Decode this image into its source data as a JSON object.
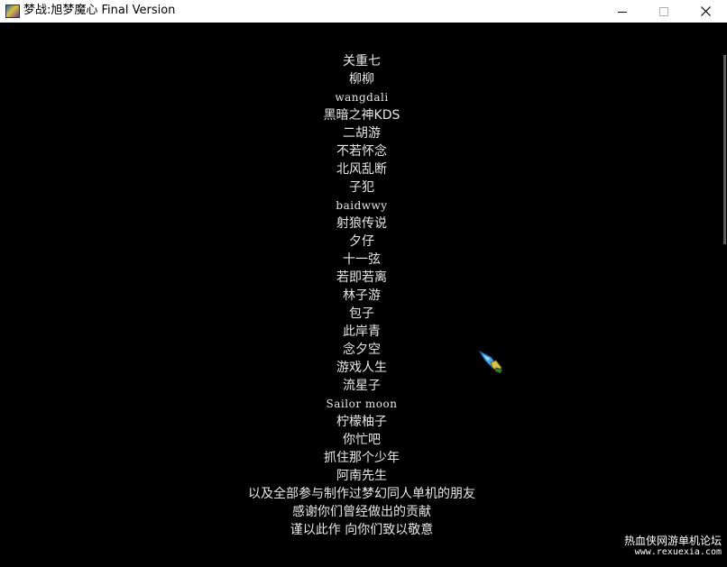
{
  "window": {
    "title": "梦战:旭梦魔心 Final Version",
    "app_icon": "game-app-icon",
    "controls": {
      "minimize_icon": "minimize-icon",
      "maximize_icon": "maximize-icon",
      "close_icon": "close-icon"
    }
  },
  "credits": [
    "关重七",
    "柳柳",
    "wangdali",
    "黑暗之神KDS",
    "二胡游",
    "不若怀念",
    "北风乱断",
    "子犯",
    "baidwwy",
    "射狼传说",
    "夕仔",
    "十一弦",
    "若即若离",
    "林子游",
    "包子",
    "此岸青",
    "念夕空",
    "游戏人生",
    "流星子",
    "Sailor moon",
    "柠檬柚子",
    "你忙吧",
    "抓住那个少年",
    "阿南先生",
    "以及全部参与制作过梦幻同人单机的朋友",
    "感谢你们曾经做出的贡献",
    "谨以此作 向你们致以敬意"
  ],
  "cursor_icon": "sword-cursor-icon",
  "watermark": {
    "line1": "热血侠网游单机论坛",
    "line2": "www.rexuexia.com"
  },
  "colors": {
    "background": "#000000",
    "text": "#e8e8e8",
    "titlebar": "#ffffff"
  }
}
